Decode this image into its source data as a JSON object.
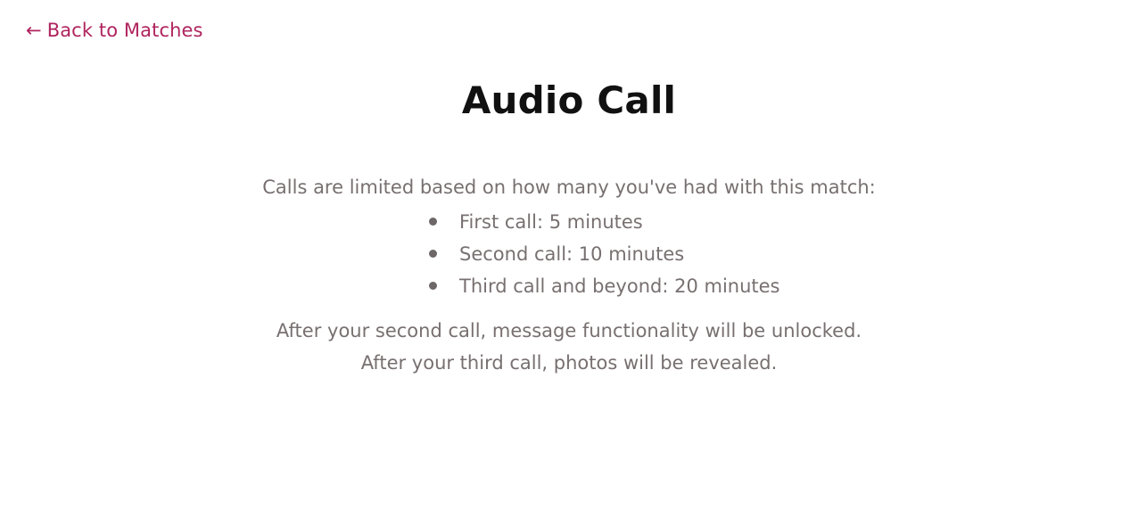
{
  "nav": {
    "back_arrow": "←",
    "back_label": "Back to Matches"
  },
  "header": {
    "title": "Audio Call"
  },
  "info": {
    "intro": "Calls are limited based on how many you've had with this match:",
    "limits": [
      "First call: 5 minutes",
      "Second call: 10 minutes",
      "Third call and beyond: 20 minutes"
    ],
    "note_messages": "After your second call, message functionality will be unlocked.",
    "note_photos": "After your third call, photos will be revealed."
  },
  "colors": {
    "link": "#b0245e",
    "title": "#111111",
    "body_text": "#787070"
  }
}
